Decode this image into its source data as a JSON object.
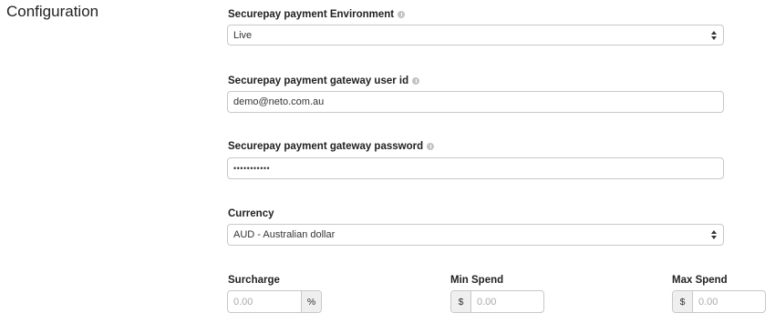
{
  "section": {
    "title": "Configuration"
  },
  "environment": {
    "label": "Securepay payment Environment",
    "selected": "Live"
  },
  "user_id": {
    "label": "Securepay payment gateway user id",
    "value": "demo@neto.com.au"
  },
  "password": {
    "label": "Securepay payment gateway password",
    "value": "•••••••••••"
  },
  "currency": {
    "label": "Currency",
    "selected": "AUD - Australian dollar"
  },
  "surcharge": {
    "label": "Surcharge",
    "placeholder": "0.00",
    "suffix": "%"
  },
  "min_spend": {
    "label": "Min Spend",
    "placeholder": "0.00",
    "prefix": "$"
  },
  "max_spend": {
    "label": "Max Spend",
    "placeholder": "0.00",
    "prefix": "$"
  }
}
